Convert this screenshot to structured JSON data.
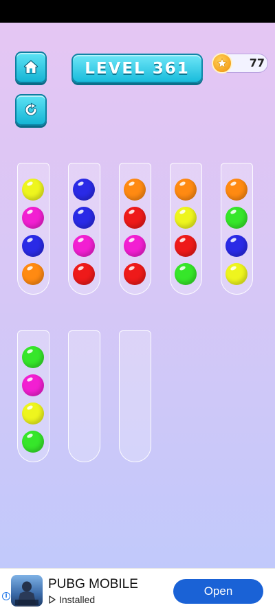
{
  "header": {
    "level_label": "LEVEL 361",
    "coins": "77",
    "home_icon": "home-icon",
    "restart_icon": "restart-icon",
    "coin_icon": "coin-star-icon"
  },
  "colors": {
    "yellow": "#eef51e",
    "magenta": "#f21fd2",
    "blue": "#2a2ae6",
    "orange": "#ff8a12",
    "red": "#ee1a1a",
    "green": "#36e62a"
  },
  "tubes": [
    {
      "balls": [
        "yellow",
        "magenta",
        "blue",
        "orange"
      ]
    },
    {
      "balls": [
        "blue",
        "blue",
        "magenta",
        "red"
      ]
    },
    {
      "balls": [
        "orange",
        "red",
        "magenta",
        "red"
      ]
    },
    {
      "balls": [
        "orange",
        "yellow",
        "red",
        "green"
      ]
    },
    {
      "balls": [
        "orange",
        "green",
        "blue",
        "yellow"
      ]
    },
    {
      "balls": [
        "green",
        "magenta",
        "yellow",
        "green"
      ]
    },
    {
      "balls": []
    },
    {
      "balls": []
    }
  ],
  "ad": {
    "title": "PUBG MOBILE",
    "status": "Installed",
    "button_label": "Open",
    "info_icon": "info-icon"
  }
}
